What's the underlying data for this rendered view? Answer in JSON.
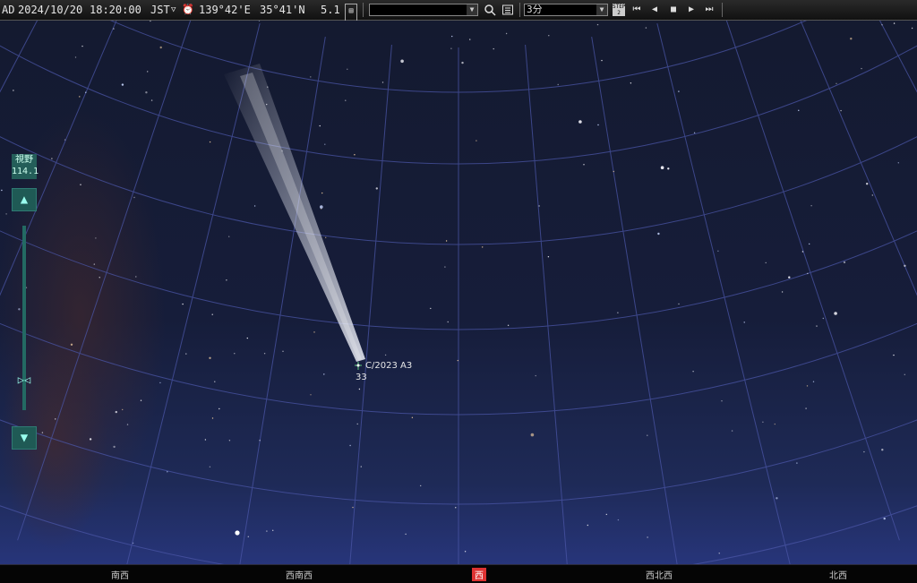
{
  "toolbar": {
    "datetime_prefix": "AD",
    "date": "2024/10/20",
    "time": "18:20:00",
    "timezone": "JST",
    "longitude": "139°42'E",
    "latitude": "35°41'N",
    "magnitude": "5.1",
    "target_value": "",
    "step_value": "3分",
    "step_badge": "STEP",
    "step_badge_num": "2"
  },
  "fov": {
    "label": "視野",
    "value": "114.1",
    "up_icon": "▲",
    "down_icon": "▼"
  },
  "comet": {
    "name": "C/2023 A3",
    "sub": "33"
  },
  "directions": [
    {
      "label": "南西",
      "active": false
    },
    {
      "label": "西南西",
      "active": false
    },
    {
      "label": "西",
      "active": true
    },
    {
      "label": "西北西",
      "active": false
    },
    {
      "label": "北西",
      "active": false
    }
  ],
  "colors": {
    "sky_top": "#141a30",
    "sky_horizon": "#27357a",
    "grid": "#4a55a6",
    "accent_teal": "#1f5a55",
    "active_direction": "#d33333"
  },
  "icons": {
    "clock": "clock-icon",
    "dropdown": "chevron-down-icon",
    "search": "search-icon",
    "list": "list-icon",
    "first": "skip-first-icon",
    "prev": "step-back-icon",
    "stop": "stop-icon",
    "play": "play-icon",
    "last": "skip-last-icon"
  }
}
